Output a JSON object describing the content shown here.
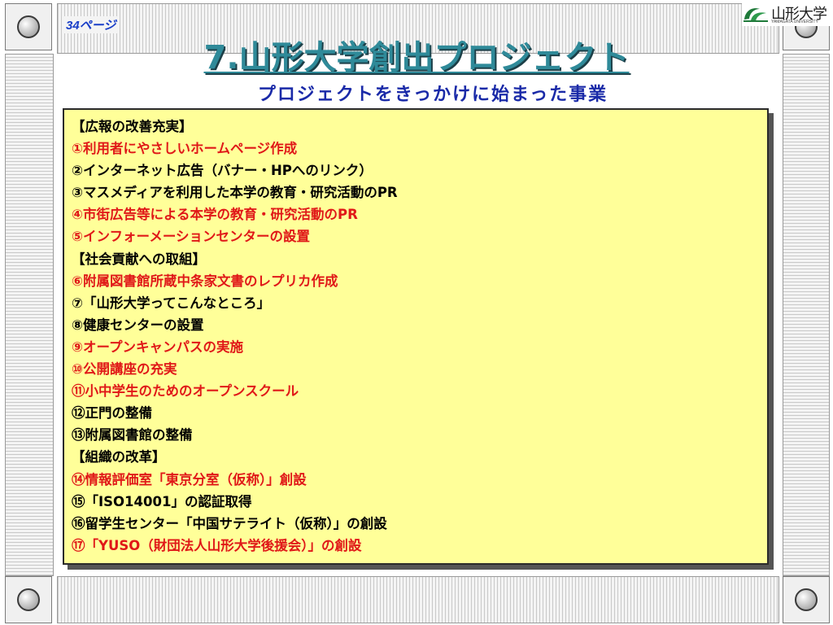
{
  "page_label": "34ページ",
  "logo": {
    "name": "山形大学",
    "subtitle": "YAMAGATA UNIVERSITY"
  },
  "title": "7.山形大学創出プロジェクト",
  "subtitle": "プロジェクトをきっかけに始まった事業",
  "colors": {
    "title": "#2f8a99",
    "subtitle": "#1a2aa8",
    "highlight_red": "#e01818",
    "box_background": "#ffff99"
  },
  "items": [
    {
      "text": "【広報の改善充実】",
      "color": "black"
    },
    {
      "text": "①利用者にやさしいホームページ作成",
      "color": "red"
    },
    {
      "text": "②インターネット広告（バナー・HPへのリンク）",
      "color": "black"
    },
    {
      "text": "③マスメディアを利用した本学の教育・研究活動のPR",
      "color": "black"
    },
    {
      "text": "④市街広告等による本学の教育・研究活動のPR",
      "color": "red"
    },
    {
      "text": "⑤インフォーメーションセンターの設置",
      "color": "red"
    },
    {
      "text": "【社会貢献への取組】",
      "color": "black"
    },
    {
      "text": "⑥附属図書館所蔵中条家文書のレプリカ作成",
      "color": "red"
    },
    {
      "text": "⑦「山形大学ってこんなところ」",
      "color": "black"
    },
    {
      "text": "⑧健康センターの設置",
      "color": "black"
    },
    {
      "text": "⑨オープンキャンパスの実施",
      "color": "red"
    },
    {
      "text": "⑩公開講座の充実",
      "color": "red"
    },
    {
      "text": "⑪小中学生のためのオープンスクール",
      "color": "red"
    },
    {
      "text": "⑫正門の整備",
      "color": "black"
    },
    {
      "text": "⑬附属図書館の整備",
      "color": "black"
    },
    {
      "text": "【組織の改革】",
      "color": "black"
    },
    {
      "text": "⑭情報評価室「東京分室（仮称）」創設",
      "color": "red"
    },
    {
      "text": "⑮「ISO14001」の認証取得",
      "color": "black"
    },
    {
      "text": "⑯留学生センター「中国サテライト（仮称）」の創設",
      "color": "black"
    },
    {
      "text": "⑰「YUSO（財団法人山形大学後援会）」の創設",
      "color": "red"
    }
  ]
}
